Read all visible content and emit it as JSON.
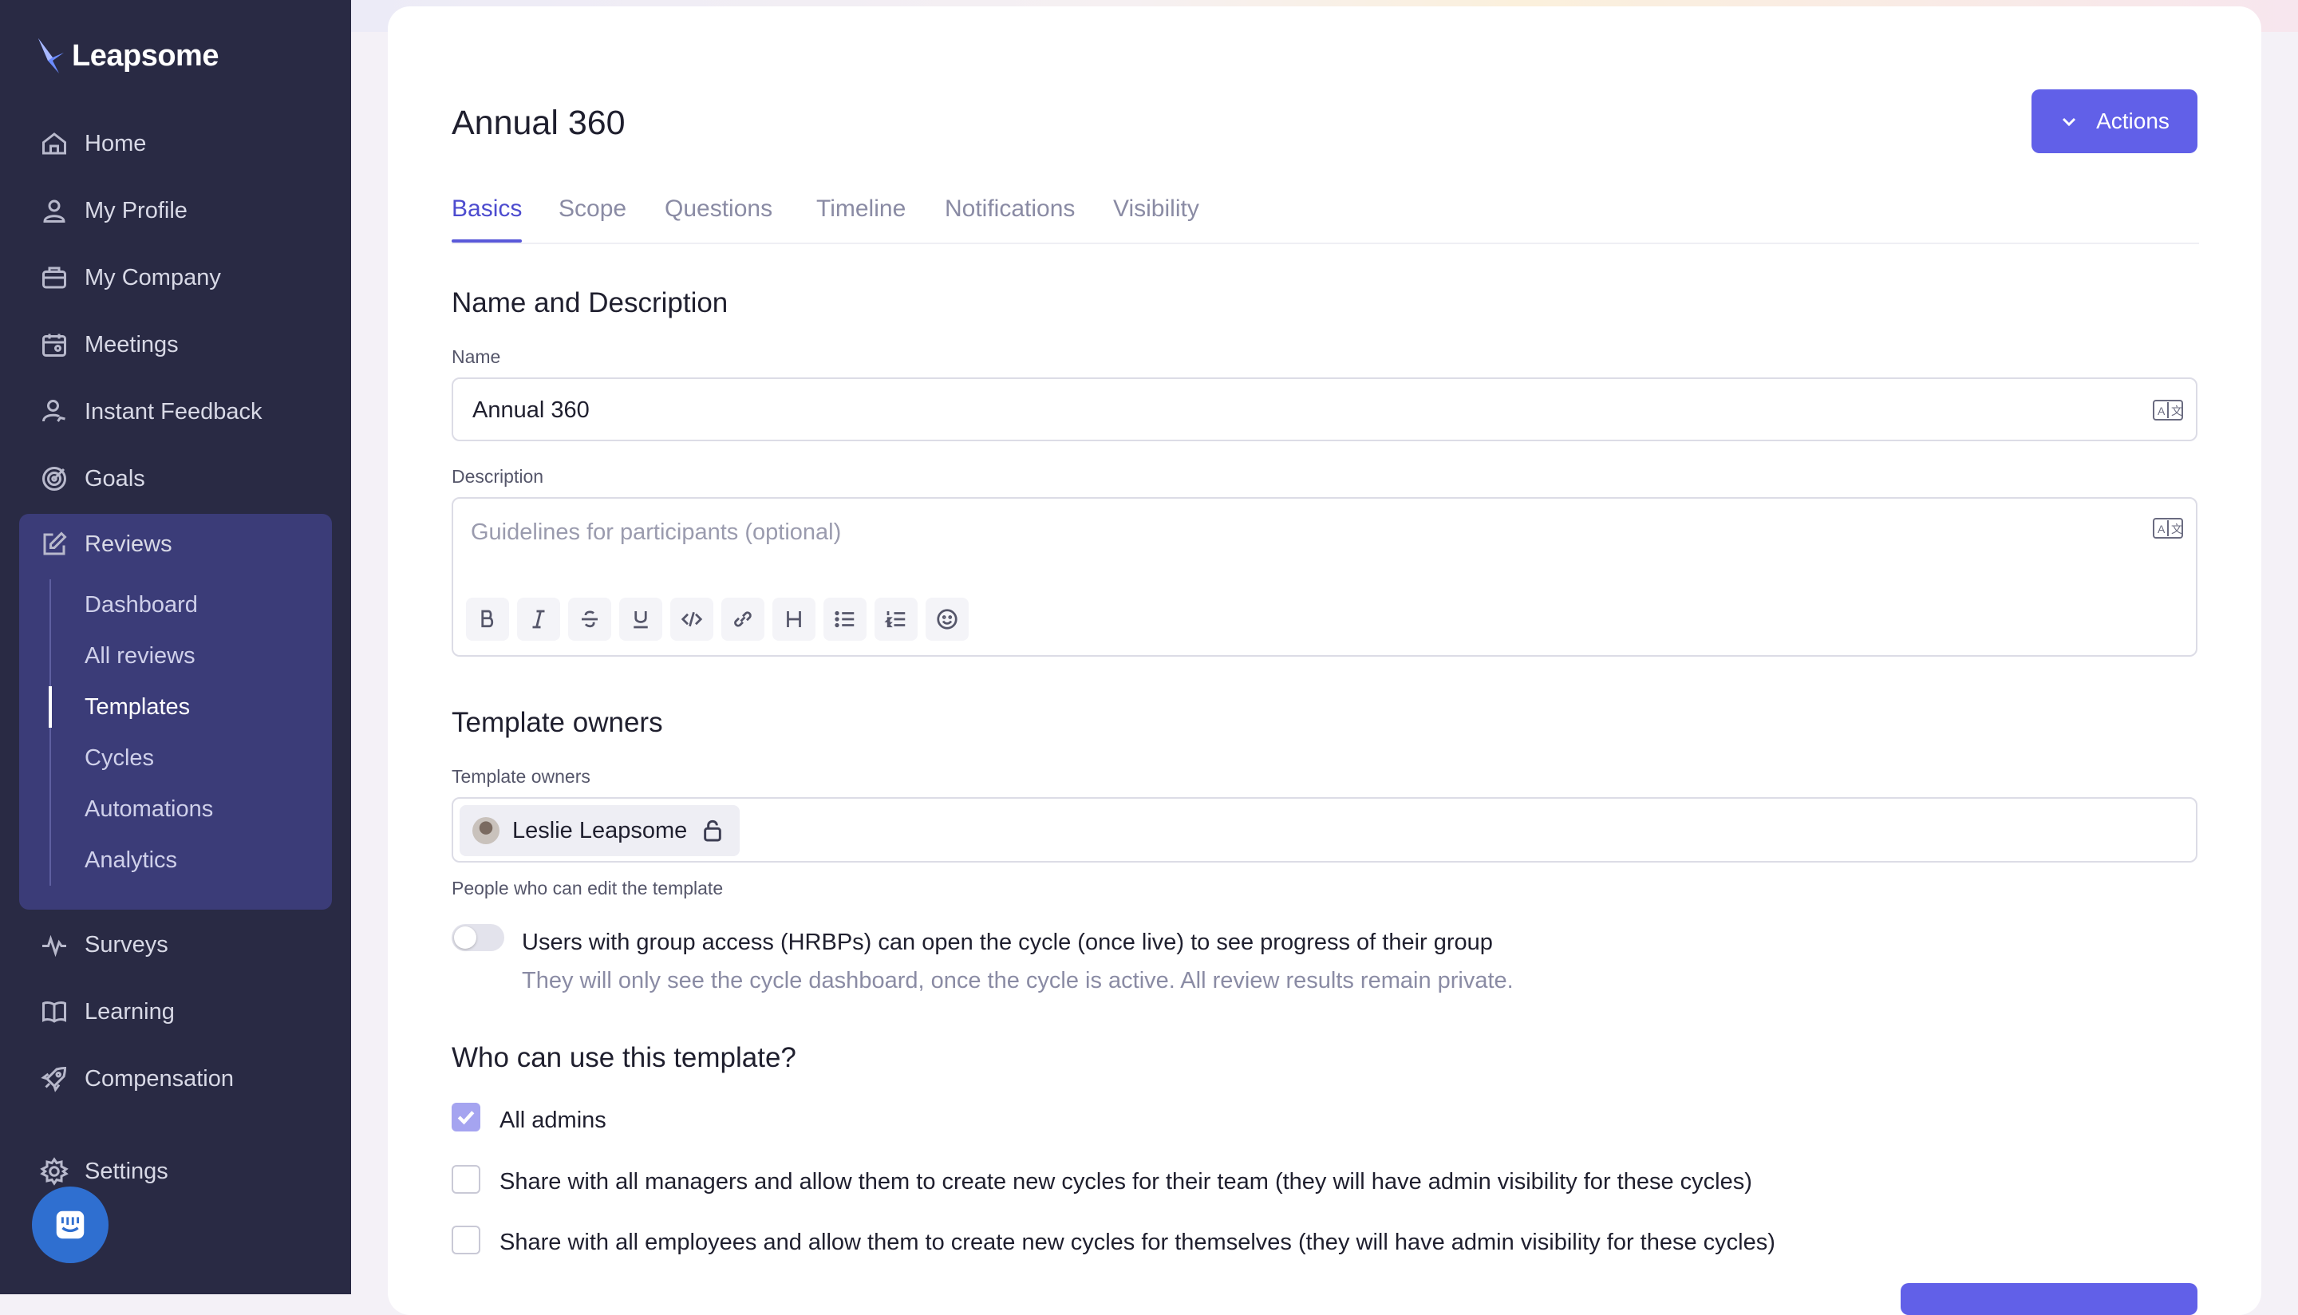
{
  "sidebar": {
    "brand": "Leapsome",
    "items": [
      {
        "label": "Home",
        "icon": "home-icon"
      },
      {
        "label": "My Profile",
        "icon": "user-icon"
      },
      {
        "label": "My Company",
        "icon": "briefcase-icon"
      },
      {
        "label": "Meetings",
        "icon": "calendar-icon"
      },
      {
        "label": "Instant Feedback",
        "icon": "feedback-icon"
      },
      {
        "label": "Goals",
        "icon": "target-icon"
      },
      {
        "label": "Reviews",
        "icon": "edit-icon"
      },
      {
        "label": "Surveys",
        "icon": "pulse-icon"
      },
      {
        "label": "Learning",
        "icon": "book-icon"
      },
      {
        "label": "Compensation",
        "icon": "rocket-icon"
      },
      {
        "label": "Settings",
        "icon": "gear-icon"
      }
    ],
    "reviews_sub": [
      "Dashboard",
      "All reviews",
      "Templates",
      "Cycles",
      "Automations",
      "Analytics"
    ],
    "active_sub": "Templates"
  },
  "header": {
    "title": "Annual 360",
    "actions_label": "Actions"
  },
  "tabs": [
    "Basics",
    "Scope",
    "Questions",
    "Timeline",
    "Notifications",
    "Visibility"
  ],
  "active_tab": "Basics",
  "name_section": {
    "heading": "Name and Description",
    "name_label": "Name",
    "name_value": "Annual 360",
    "description_label": "Description",
    "description_placeholder": "Guidelines for participants (optional)",
    "toolbar": [
      "bold",
      "italic",
      "strikethrough",
      "underline",
      "code",
      "link",
      "heading",
      "bullet-list",
      "numbered-list",
      "emoji"
    ]
  },
  "owners_section": {
    "heading": "Template owners",
    "label": "Template owners",
    "owner_name": "Leslie Leapsome",
    "help": "People who can edit the template",
    "toggle_label": "Users with group access (HRBPs) can open the cycle (once live) to see progress of their group",
    "toggle_sub": "They will only see the cycle dashboard, once the cycle is active. All review results remain private.",
    "toggle_on": false
  },
  "usage_section": {
    "heading": "Who can use this template?",
    "options": [
      {
        "label": "All admins",
        "checked": true
      },
      {
        "label": "Share with all managers and allow them to create new cycles for their team (they will have admin visibility for these cycles)",
        "checked": false
      },
      {
        "label": "Share with all employees and allow them to create new cycles for themselves (they will have admin visibility for these cycles)",
        "checked": false
      }
    ]
  },
  "colors": {
    "sidebar_bg": "#292a44",
    "sidebar_active_bg": "#3b3c78",
    "accent": "#6160e8"
  }
}
